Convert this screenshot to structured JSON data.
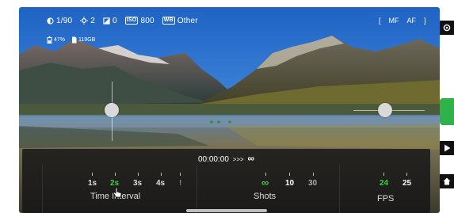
{
  "status": {
    "shutter": "1/90",
    "ev": "2",
    "wb_value": "0",
    "iso_badge": "ISO",
    "iso_value": "800",
    "wb_badge": "WB",
    "wb_mode": "Other",
    "focus_open": "[",
    "focus_mf": "MF",
    "focus_af": "AF",
    "focus_close": "]"
  },
  "sub_status": {
    "battery": "47%",
    "storage": "119GB"
  },
  "timer": {
    "time": "00:00:00",
    "arrows": ">>>",
    "infinity": "∞"
  },
  "interval": {
    "label": "Time Interval",
    "options": [
      "1s",
      "2s",
      "3s",
      "4s",
      "!"
    ],
    "selected_index": 1
  },
  "shots": {
    "label": "Shots",
    "options": [
      "∞",
      "10",
      "30"
    ],
    "selected_index": 0
  },
  "fps": {
    "label": "FPS",
    "options": [
      "24",
      "25"
    ],
    "selected_index": 0
  },
  "colors": {
    "accent": "#3cd23c",
    "panel": "#141416",
    "shutter_button": "#2db34a"
  },
  "icons": [
    "aperture-icon",
    "sun-icon",
    "wb-icon",
    "battery-icon",
    "sdcard-icon",
    "settings-icon",
    "play-icon",
    "home-icon",
    "cursor-hand-icon"
  ]
}
